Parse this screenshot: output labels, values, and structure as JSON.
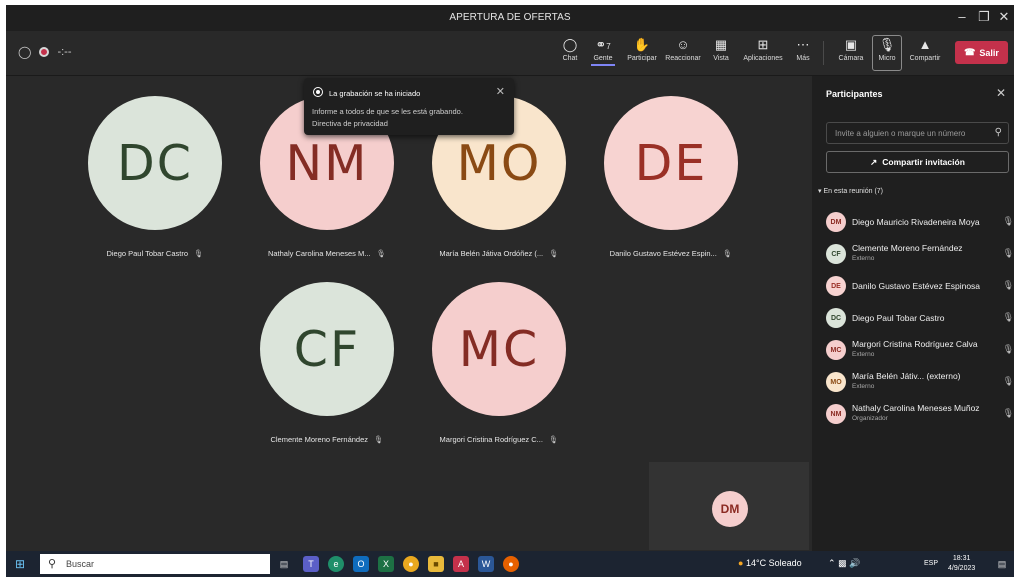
{
  "window": {
    "title": "APERTURA DE OFERTAS"
  },
  "toolbar": {
    "left_text": "-:--",
    "buttons": {
      "chat": "Chat",
      "people": "Gente",
      "people_count": "7",
      "raise": "Participar",
      "react": "Reaccionar",
      "view": "Vista",
      "apps": "Aplicaciones",
      "more": "Más",
      "camera": "Cámara",
      "mic": "Micro",
      "share": "Compartir",
      "leave": "Salir"
    }
  },
  "toast": {
    "title": "La grabación se ha iniciado",
    "line1": "Informe a todos de que se les está grabando.",
    "line2": "Directiva de privacidad"
  },
  "tiles": [
    {
      "initials": "DC",
      "name": "Diego Paul Tobar Castro"
    },
    {
      "initials": "NM",
      "name": "Nathaly Carolina Meneses M..."
    },
    {
      "initials": "MO",
      "name": "María Belén Játiva Ordóñez (..."
    },
    {
      "initials": "DE",
      "name": "Danilo Gustavo Estévez Espin..."
    },
    {
      "initials": "CF",
      "name": "Clemente Moreno Fernández"
    },
    {
      "initials": "MC",
      "name": "Margori Cristina Rodríguez C..."
    }
  ],
  "self_view": {
    "initials": "DM"
  },
  "panel": {
    "title": "Participantes",
    "search_placeholder": "Invite a alguien o marque un número",
    "share_label": "Compartir invitación",
    "section": "En esta reunión (7)",
    "participants": [
      {
        "initials": "DM",
        "name": "Diego Mauricio Rivadeneira Moya",
        "sub": ""
      },
      {
        "initials": "CF",
        "name": "Clemente Moreno Fernández",
        "sub": "Externo"
      },
      {
        "initials": "DE",
        "name": "Danilo Gustavo Estévez Espinosa",
        "sub": ""
      },
      {
        "initials": "DC",
        "name": "Diego Paul Tobar Castro",
        "sub": ""
      },
      {
        "initials": "MC",
        "name": "Margori Cristina Rodríguez Calva",
        "sub": "Externo"
      },
      {
        "initials": "MO",
        "name": "María Belén Játiv... (externo)",
        "sub": "Externo"
      },
      {
        "initials": "NM",
        "name": "Nathaly Carolina Meneses Muñoz",
        "sub": "Organizador"
      }
    ]
  },
  "taskbar": {
    "search": "Buscar",
    "weather": "14°C Soleado",
    "lang": "ESP",
    "time": "18:31",
    "date": "4/9/2023"
  },
  "colors": {
    "accent": "#7f85f5",
    "leave": "#c4314b",
    "avatar_green": "#dbe4da",
    "avatar_pink": "#f5cecd",
    "avatar_cream": "#f9e5cc"
  }
}
